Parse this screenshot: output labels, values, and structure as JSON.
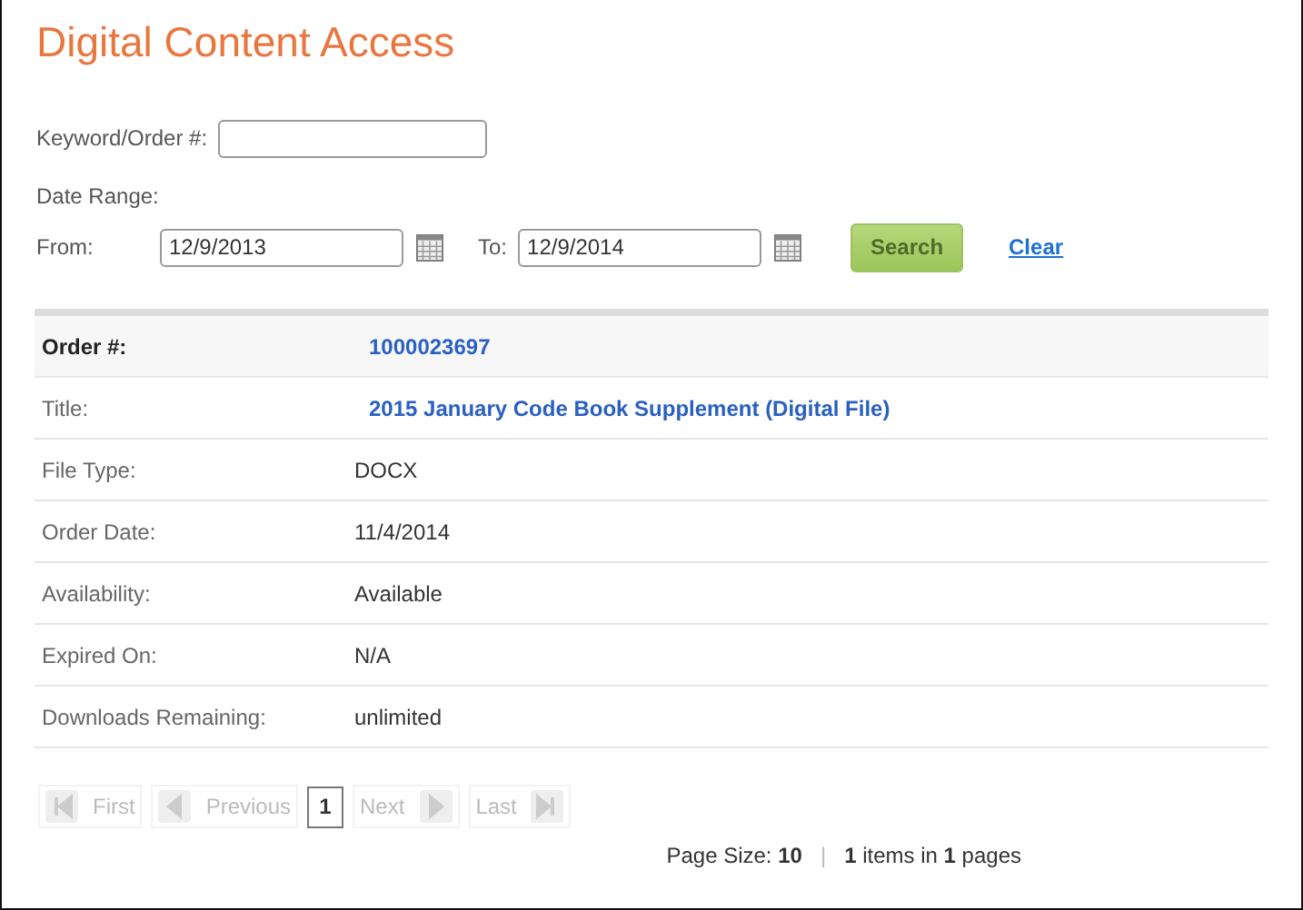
{
  "page": {
    "title": "Digital Content Access"
  },
  "search": {
    "keyword_label": "Keyword/Order #:",
    "date_range_label": "Date Range:",
    "from_label": "From:",
    "from_value": "12/9/2013",
    "to_label": "To:",
    "to_value": "12/9/2014",
    "search_button": "Search",
    "clear_link": "Clear"
  },
  "details": [
    {
      "label": "Order #:",
      "value": "1000023697",
      "kind": "header"
    },
    {
      "label": "Title:",
      "value": "2015 January Code Book Supplement (Digital File)",
      "kind": "link"
    },
    {
      "label": "File Type:",
      "value": "DOCX",
      "kind": "text"
    },
    {
      "label": "Order Date:",
      "value": "11/4/2014",
      "kind": "text"
    },
    {
      "label": "Availability:",
      "value": "Available",
      "kind": "text"
    },
    {
      "label": "Expired On:",
      "value": "N/A",
      "kind": "text"
    },
    {
      "label": "Downloads Remaining:",
      "value": "unlimited",
      "kind": "text"
    }
  ],
  "pager": {
    "nav": [
      {
        "label": "First",
        "kind": "first",
        "disabled": true
      },
      {
        "label": "Previous",
        "kind": "prev",
        "disabled": true
      }
    ],
    "pages": [
      {
        "label": "1",
        "selected": true
      }
    ],
    "nav_after": [
      {
        "label": "Next",
        "kind": "next",
        "disabled": true
      },
      {
        "label": "Last",
        "kind": "last",
        "disabled": true
      }
    ],
    "page_size": "Page Size: **10**",
    "separator": "|",
    "summary": "**1** items in **1** pages"
  }
}
